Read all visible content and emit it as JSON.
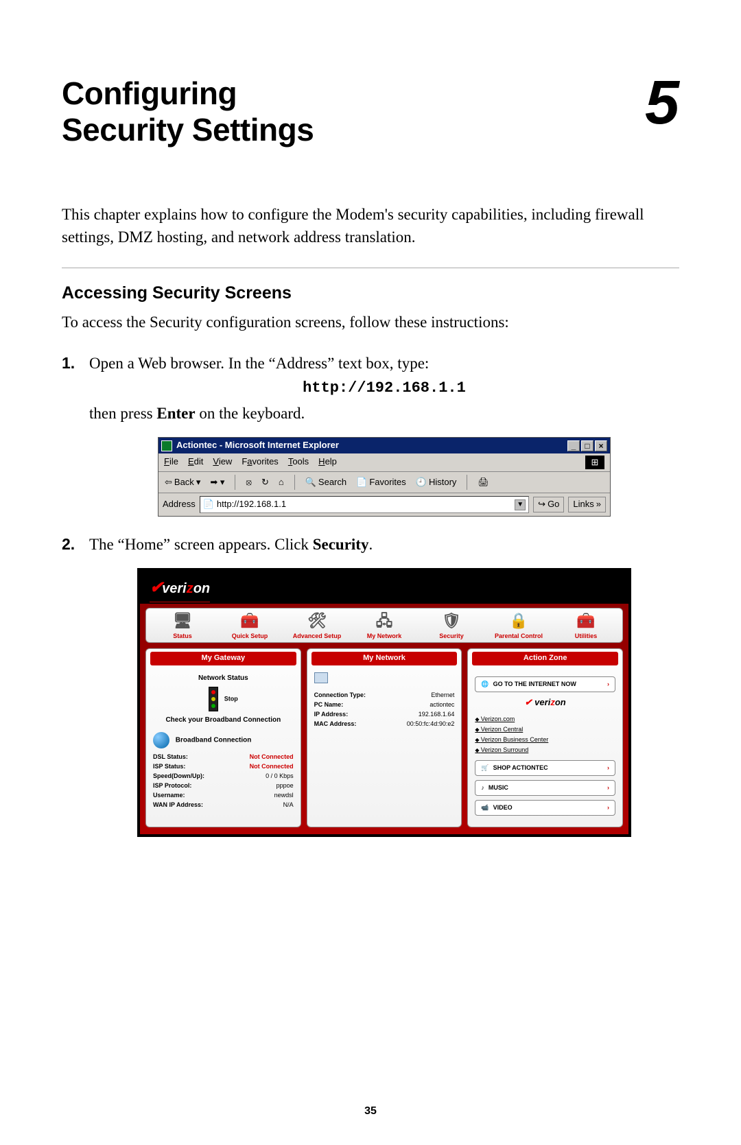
{
  "chapter": {
    "title_line1": "Configuring",
    "title_line2": "Security Settings",
    "number": "5"
  },
  "intro_pre": "This chapter explains how to configure the Modem's security capabilities, including firewall settings, ",
  "intro_dmz": "DMZ",
  "intro_post": " hosting, and network address translation.",
  "section": {
    "heading": "Accessing Security Screens",
    "intro": "To access the Security configuration screens, follow these instructions:"
  },
  "steps": {
    "s1_a": "Open a Web browser. In the “Address” text box, type:",
    "s1_url": "http://192.168.1.1",
    "s1_b_pre": "then press ",
    "s1_b_bold": "Enter",
    "s1_b_post": " on the keyboard.",
    "s2_pre": "The “Home” screen appears. Click ",
    "s2_bold": "Security",
    "s2_post": "."
  },
  "browser": {
    "title": "Actiontec - Microsoft Internet Explorer",
    "menus": {
      "file": "File",
      "edit": "Edit",
      "view": "View",
      "favorites": "Favorites",
      "tools": "Tools",
      "help": "Help"
    },
    "toolbar": {
      "back": "Back",
      "search": "Search",
      "favorites": "Favorites",
      "history": "History"
    },
    "address_label": "Address",
    "address_value": "http://192.168.1.1",
    "go": "Go",
    "links": "Links"
  },
  "router": {
    "brand": "verizon",
    "nav": [
      "Status",
      "Quick Setup",
      "Advanced Setup",
      "My Network",
      "Security",
      "Parental Control",
      "Utilities"
    ],
    "panels": {
      "gateway": {
        "title": "My Gateway",
        "network_status": "Network Status",
        "stop": "Stop",
        "check": "Check your Broadband Connection",
        "bb": "Broadband Connection",
        "rows": [
          {
            "lab": "DSL Status:",
            "val": "Not Connected",
            "red": true
          },
          {
            "lab": "ISP Status:",
            "val": "Not Connected",
            "red": true
          },
          {
            "lab": "Speed(Down/Up):",
            "val": "0 / 0 Kbps"
          },
          {
            "lab": "ISP Protocol:",
            "val": "pppoe"
          },
          {
            "lab": "Username:",
            "val": "newdsl"
          },
          {
            "lab": "WAN IP Address:",
            "val": "N/A"
          }
        ]
      },
      "network": {
        "title": "My Network",
        "rows": [
          {
            "lab": "Connection Type:",
            "val": "Ethernet"
          },
          {
            "lab": "PC Name:",
            "val": "actiontec"
          },
          {
            "lab": "IP Address:",
            "val": "192.168.1.64"
          },
          {
            "lab": "MAC Address:",
            "val": "00:50:fc:4d:90:e2"
          }
        ]
      },
      "action": {
        "title": "Action Zone",
        "go_internet": "GO TO THE INTERNET NOW",
        "links": [
          "Verizon.com",
          "Verizon Central",
          "Verizon Business Center",
          "Verizon Surround"
        ],
        "shop": "SHOP ACTIONTEC",
        "music": "MUSIC",
        "video": "VIDEO"
      }
    }
  },
  "page_number": "35"
}
